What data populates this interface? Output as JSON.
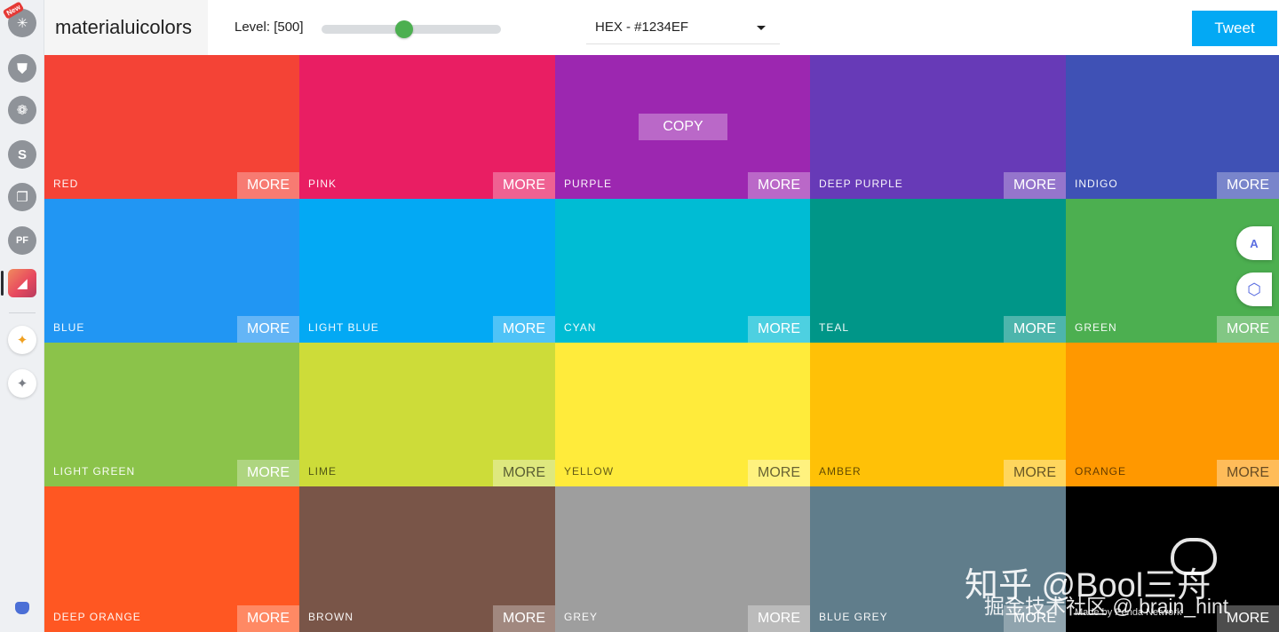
{
  "header": {
    "brand": "materialuicolors",
    "level_label": "Level: [500]",
    "level_slider": {
      "position_fraction": 0.46
    },
    "format_select": {
      "value": "HEX - #1234EF"
    },
    "tweet_label": "Tweet"
  },
  "sidebar": {
    "new_badge": "New",
    "items": [
      {
        "icon": "sparkle-icon",
        "glyph": "✳"
      },
      {
        "icon": "shield-icon",
        "glyph": "⛊"
      },
      {
        "icon": "palette-icon",
        "glyph": "❁"
      },
      {
        "icon": "s-icon",
        "glyph": "S"
      },
      {
        "icon": "layers-icon",
        "glyph": "❐"
      },
      {
        "icon": "pf-icon",
        "glyph": "PF"
      },
      {
        "icon": "active-app-icon",
        "glyph": "◢"
      },
      {
        "icon": "duck-icon",
        "glyph": "✦"
      },
      {
        "icon": "star-icon",
        "glyph": "✦"
      }
    ]
  },
  "actions": {
    "more_label": "MORE",
    "copy_label": "COPY"
  },
  "colors": [
    {
      "name": "RED",
      "hex": "#f44336",
      "dark": false
    },
    {
      "name": "PINK",
      "hex": "#e91e63",
      "dark": false
    },
    {
      "name": "PURPLE",
      "hex": "#9c27b0",
      "dark": false
    },
    {
      "name": "DEEP PURPLE",
      "hex": "#673ab7",
      "dark": false
    },
    {
      "name": "INDIGO",
      "hex": "#3f51b5",
      "dark": false
    },
    {
      "name": "BLUE",
      "hex": "#2196f3",
      "dark": false
    },
    {
      "name": "LIGHT BLUE",
      "hex": "#03a9f4",
      "dark": false
    },
    {
      "name": "CYAN",
      "hex": "#00bcd4",
      "dark": false
    },
    {
      "name": "TEAL",
      "hex": "#009688",
      "dark": false
    },
    {
      "name": "GREEN",
      "hex": "#4caf50",
      "dark": false
    },
    {
      "name": "LIGHT GREEN",
      "hex": "#8bc34a",
      "dark": false
    },
    {
      "name": "LIME",
      "hex": "#cddc39",
      "dark": true
    },
    {
      "name": "YELLOW",
      "hex": "#ffeb3b",
      "dark": true
    },
    {
      "name": "AMBER",
      "hex": "#ffc107",
      "dark": true
    },
    {
      "name": "ORANGE",
      "hex": "#ff9800",
      "dark": true
    },
    {
      "name": "DEEP ORANGE",
      "hex": "#ff5722",
      "dark": false
    },
    {
      "name": "BROWN",
      "hex": "#795548",
      "dark": false
    },
    {
      "name": "GREY",
      "hex": "#9e9e9e",
      "dark": false
    },
    {
      "name": "BLUE GREY",
      "hex": "#607d8b",
      "dark": false
    },
    {
      "name": "",
      "hex": "#000000",
      "dark": false
    }
  ],
  "made_by": "Made by Penda Network",
  "float_buttons": [
    {
      "icon": "translate-icon",
      "glyph": "A"
    },
    {
      "icon": "hexagon-icon",
      "glyph": "⬡"
    }
  ],
  "watermark": {
    "line1": "知乎 @Bool三舟",
    "line2": "掘金技术社区 @ brain_hint"
  }
}
